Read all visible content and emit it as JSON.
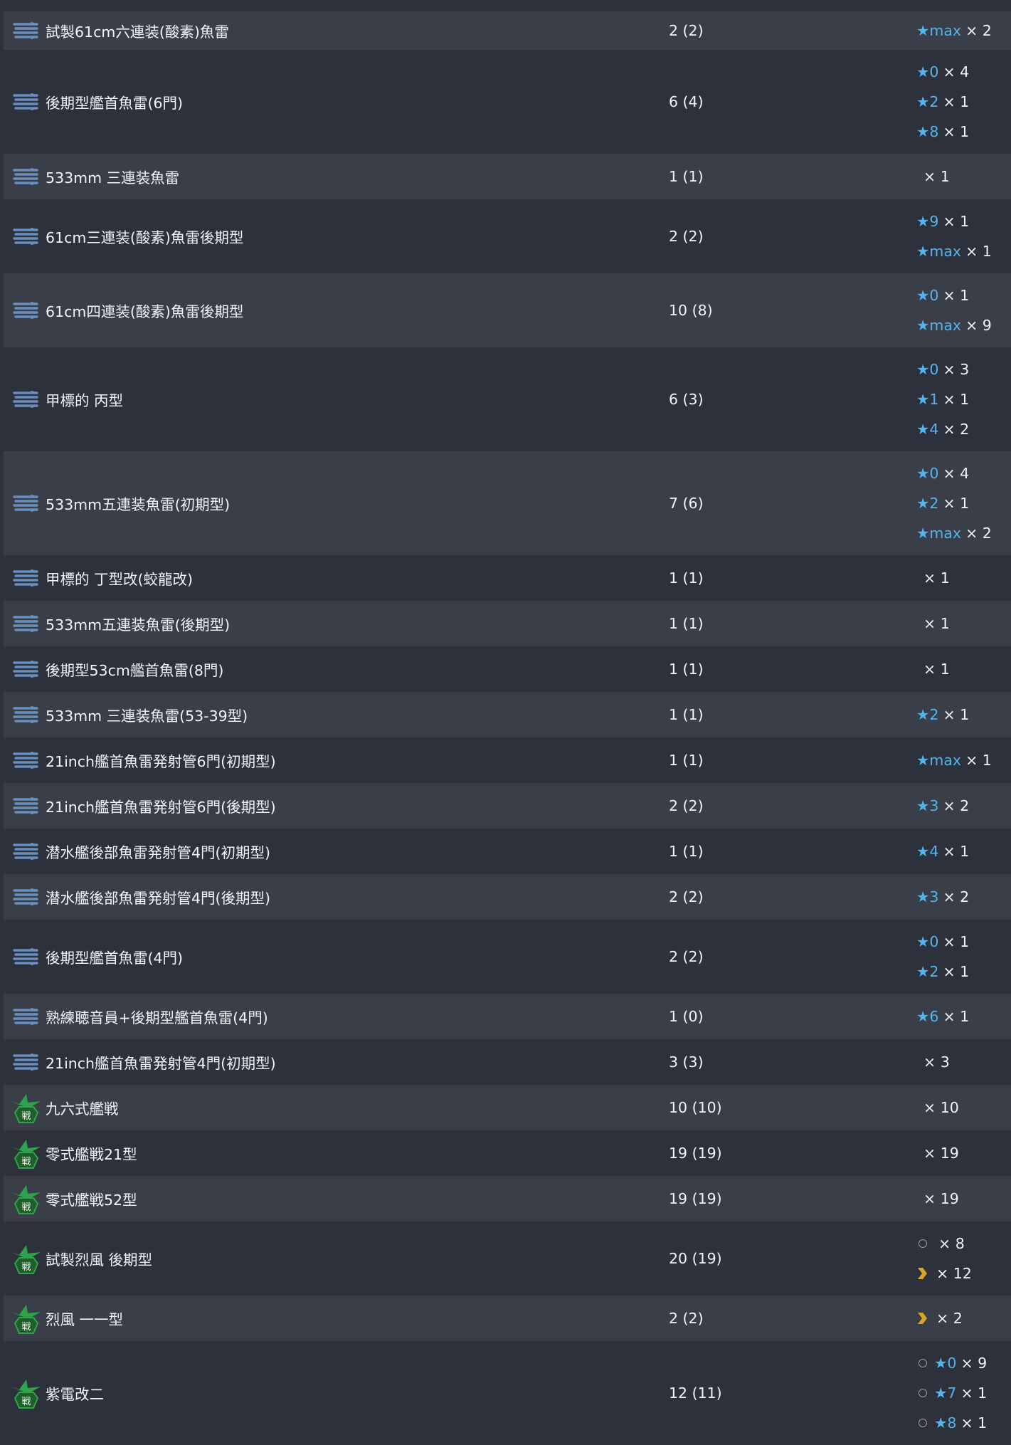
{
  "icons": {
    "torpedo": "torpedo-icon",
    "fighter": "fighter-icon",
    "fighter_label": "戦",
    "proficiency": "proficiency-chevron-icon",
    "unknown_proficiency": "unknown-proficiency-circle-icon",
    "star_symbol": "★"
  },
  "colors": {
    "star": "#53b4ee",
    "torpedo": "#6a8fbe",
    "fighter": "#2fa34a",
    "chevron": "#d9a527"
  },
  "rows": [
    {
      "icon": "torpedo",
      "name": "試製61cm六連装(酸素)魚雷",
      "count": "2 (2)",
      "levels": [
        {
          "star": "max",
          "mult": "× 2"
        }
      ]
    },
    {
      "icon": "torpedo",
      "name": "後期型艦首魚雷(6門)",
      "count": "6 (4)",
      "levels": [
        {
          "star": "0",
          "mult": "× 4"
        },
        {
          "star": "2",
          "mult": "× 1"
        },
        {
          "star": "8",
          "mult": "× 1"
        }
      ]
    },
    {
      "icon": "torpedo",
      "name": "533mm 三連装魚雷",
      "count": "1 (1)",
      "levels": [
        {
          "mult": "× 1"
        }
      ]
    },
    {
      "icon": "torpedo",
      "name": "61cm三連装(酸素)魚雷後期型",
      "count": "2 (2)",
      "levels": [
        {
          "star": "9",
          "mult": "× 1"
        },
        {
          "star": "max",
          "mult": "× 1"
        }
      ]
    },
    {
      "icon": "torpedo",
      "name": "61cm四連装(酸素)魚雷後期型",
      "count": "10 (8)",
      "levels": [
        {
          "star": "0",
          "mult": "× 1"
        },
        {
          "star": "max",
          "mult": "× 9"
        }
      ]
    },
    {
      "icon": "torpedo",
      "name": "甲標的 丙型",
      "count": "6 (3)",
      "levels": [
        {
          "star": "0",
          "mult": "× 3"
        },
        {
          "star": "1",
          "mult": "× 1"
        },
        {
          "star": "4",
          "mult": "× 2"
        }
      ]
    },
    {
      "icon": "torpedo",
      "name": "533mm五連装魚雷(初期型)",
      "count": "7 (6)",
      "levels": [
        {
          "star": "0",
          "mult": "× 4"
        },
        {
          "star": "2",
          "mult": "× 1"
        },
        {
          "star": "max",
          "mult": "× 2"
        }
      ]
    },
    {
      "icon": "torpedo",
      "name": "甲標的 丁型改(蛟龍改)",
      "count": "1 (1)",
      "levels": [
        {
          "mult": "× 1"
        }
      ]
    },
    {
      "icon": "torpedo",
      "name": "533mm五連装魚雷(後期型)",
      "count": "1 (1)",
      "levels": [
        {
          "mult": "× 1"
        }
      ]
    },
    {
      "icon": "torpedo",
      "name": "後期型53cm艦首魚雷(8門)",
      "count": "1 (1)",
      "levels": [
        {
          "mult": "× 1"
        }
      ]
    },
    {
      "icon": "torpedo",
      "name": "533mm 三連装魚雷(53-39型)",
      "count": "1 (1)",
      "levels": [
        {
          "star": "2",
          "mult": "× 1"
        }
      ]
    },
    {
      "icon": "torpedo",
      "name": "21inch艦首魚雷発射管6門(初期型)",
      "count": "1 (1)",
      "levels": [
        {
          "star": "max",
          "mult": "× 1"
        }
      ]
    },
    {
      "icon": "torpedo",
      "name": "21inch艦首魚雷発射管6門(後期型)",
      "count": "2 (2)",
      "levels": [
        {
          "star": "3",
          "mult": "× 2"
        }
      ]
    },
    {
      "icon": "torpedo",
      "name": "潜水艦後部魚雷発射管4門(初期型)",
      "count": "1 (1)",
      "levels": [
        {
          "star": "4",
          "mult": "× 1"
        }
      ]
    },
    {
      "icon": "torpedo",
      "name": "潜水艦後部魚雷発射管4門(後期型)",
      "count": "2 (2)",
      "levels": [
        {
          "star": "3",
          "mult": "× 2"
        }
      ]
    },
    {
      "icon": "torpedo",
      "name": "後期型艦首魚雷(4門)",
      "count": "2 (2)",
      "levels": [
        {
          "star": "0",
          "mult": "× 1"
        },
        {
          "star": "2",
          "mult": "× 1"
        }
      ]
    },
    {
      "icon": "torpedo",
      "name": "熟練聴音員+後期型艦首魚雷(4門)",
      "count": "1 (0)",
      "levels": [
        {
          "star": "6",
          "mult": "× 1"
        }
      ]
    },
    {
      "icon": "torpedo",
      "name": "21inch艦首魚雷発射管4門(初期型)",
      "count": "3 (3)",
      "levels": [
        {
          "mult": "× 3"
        }
      ]
    },
    {
      "icon": "fighter",
      "name": "九六式艦戦",
      "count": "10 (10)",
      "levels": [
        {
          "mult": "× 10"
        }
      ]
    },
    {
      "icon": "fighter",
      "name": "零式艦戦21型",
      "count": "19 (19)",
      "levels": [
        {
          "mult": "× 19"
        }
      ]
    },
    {
      "icon": "fighter",
      "name": "零式艦戦52型",
      "count": "19 (19)",
      "levels": [
        {
          "mult": "× 19"
        }
      ]
    },
    {
      "icon": "fighter",
      "name": "試製烈風 後期型",
      "count": "20 (19)",
      "levels": [
        {
          "prof": "unknown",
          "mult": "× 8"
        },
        {
          "prof": "chevron",
          "mult": "× 12"
        }
      ]
    },
    {
      "icon": "fighter",
      "name": "烈風 一一型",
      "count": "2 (2)",
      "levels": [
        {
          "prof": "chevron",
          "mult": "× 2"
        }
      ]
    },
    {
      "icon": "fighter",
      "name": "紫電改二",
      "count": "12 (11)",
      "levels": [
        {
          "prof": "unknown",
          "star": "0",
          "mult": "× 9"
        },
        {
          "prof": "unknown",
          "star": "7",
          "mult": "× 1"
        },
        {
          "prof": "unknown",
          "star": "8",
          "mult": "× 1"
        }
      ]
    }
  ]
}
